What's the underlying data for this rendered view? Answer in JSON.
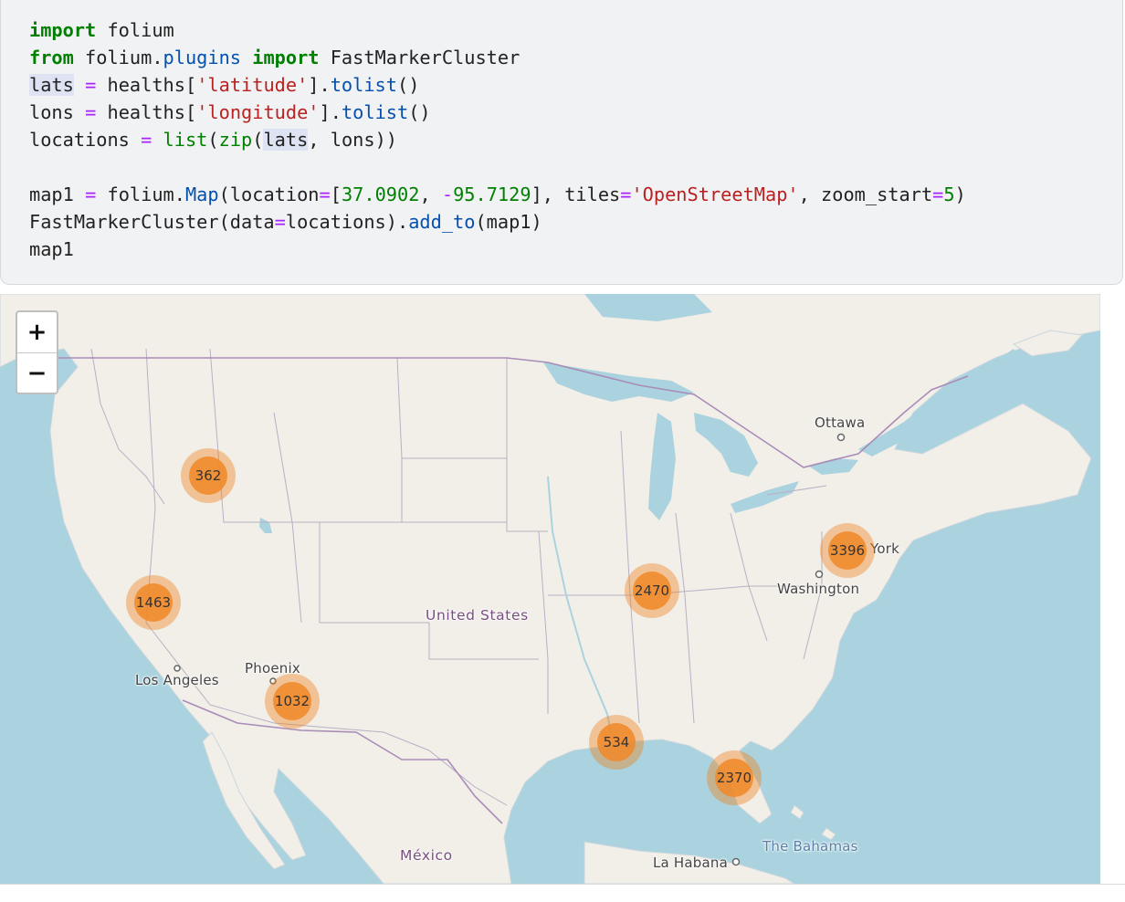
{
  "code": {
    "lines": [
      [
        {
          "t": "import",
          "c": "kw"
        },
        {
          "t": " folium"
        }
      ],
      [
        {
          "t": "from",
          "c": "kw"
        },
        {
          "t": " folium."
        },
        {
          "t": "plugins",
          "c": "at"
        },
        {
          "t": " "
        },
        {
          "t": "import",
          "c": "kw"
        },
        {
          "t": " FastMarkerCluster"
        }
      ],
      [
        {
          "t": "lats",
          "c": "hl"
        },
        {
          "t": " "
        },
        {
          "t": "=",
          "c": "op"
        },
        {
          "t": " healths["
        },
        {
          "t": "'latitude'",
          "c": "st"
        },
        {
          "t": "]."
        },
        {
          "t": "tolist",
          "c": "at"
        },
        {
          "t": "()"
        }
      ],
      [
        {
          "t": "lons "
        },
        {
          "t": "=",
          "c": "op"
        },
        {
          "t": " healths["
        },
        {
          "t": "'longitude'",
          "c": "st"
        },
        {
          "t": "]."
        },
        {
          "t": "tolist",
          "c": "at"
        },
        {
          "t": "()"
        }
      ],
      [
        {
          "t": "locations "
        },
        {
          "t": "=",
          "c": "op"
        },
        {
          "t": " "
        },
        {
          "t": "list",
          "c": "nm"
        },
        {
          "t": "("
        },
        {
          "t": "zip",
          "c": "nm"
        },
        {
          "t": "("
        },
        {
          "t": "lats",
          "c": "hl"
        },
        {
          "t": ", lons))"
        }
      ],
      [],
      [
        {
          "t": "map1 "
        },
        {
          "t": "=",
          "c": "op"
        },
        {
          "t": " folium."
        },
        {
          "t": "Map",
          "c": "at"
        },
        {
          "t": "(location"
        },
        {
          "t": "=",
          "c": "op"
        },
        {
          "t": "["
        },
        {
          "t": "37.0902",
          "c": "nm"
        },
        {
          "t": ", "
        },
        {
          "t": "-",
          "c": "op"
        },
        {
          "t": "95.7129",
          "c": "nm"
        },
        {
          "t": "], tiles"
        },
        {
          "t": "=",
          "c": "op"
        },
        {
          "t": "'OpenStreetMap'",
          "c": "st"
        },
        {
          "t": ", zoom_start"
        },
        {
          "t": "=",
          "c": "op"
        },
        {
          "t": "5",
          "c": "nm"
        },
        {
          "t": ")"
        }
      ],
      [
        {
          "t": "FastMarkerCluster(data"
        },
        {
          "t": "=",
          "c": "op"
        },
        {
          "t": "locations)."
        },
        {
          "t": "add_to",
          "c": "at"
        },
        {
          "t": "(map1)"
        }
      ],
      [
        {
          "t": "map1"
        }
      ]
    ]
  },
  "map": {
    "zoom_in_label": "+",
    "zoom_out_label": "−",
    "labels": {
      "ottawa": "Ottawa",
      "new_york": "York",
      "washington": "Washington",
      "united_states": "United States",
      "phoenix": "Phoenix",
      "los_angeles": "Los Angeles",
      "mexico": "México",
      "la_habana": "La Habana",
      "bahamas": "The Bahamas"
    },
    "clusters": {
      "idaho": "362",
      "california": "1463",
      "arizona": "1032",
      "indiana": "2470",
      "new_york": "3396",
      "louisiana": "534",
      "florida": "2370"
    },
    "colors": {
      "water": "#aad3df",
      "land": "#f2efe9",
      "cluster_outer": "#f5b273",
      "cluster_inner": "#f08828"
    }
  }
}
